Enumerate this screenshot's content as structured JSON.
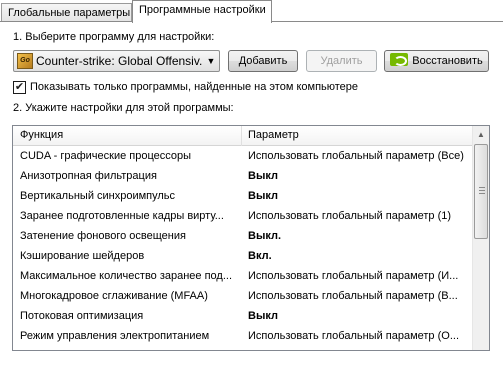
{
  "tabs": [
    {
      "label": "Глобальные параметры",
      "active": false
    },
    {
      "label": "Программные настройки",
      "active": true
    }
  ],
  "step1": {
    "label": "1. Выберите программу для настройки:",
    "program": "Counter-strike: Global Offensiv...",
    "program_icon": "csgo-icon",
    "add_label": "Добавить",
    "remove_label": "Удалить",
    "restore_label": "Восстановить",
    "restore_icon": "nvidia-icon"
  },
  "filter": {
    "checked": true,
    "label": "Показывать только программы, найденные на этом компьютере"
  },
  "step2": {
    "label": "2. Укажите настройки для этой программы:"
  },
  "grid": {
    "headers": {
      "function": "Функция",
      "parameter": "Параметр"
    },
    "rows": [
      {
        "function": "CUDA - графические процессоры",
        "value": "Использовать глобальный параметр (Все)",
        "bold": false
      },
      {
        "function": "Анизотропная фильтрация",
        "value": "Выкл",
        "bold": true
      },
      {
        "function": "Вертикальный синхроимпульс",
        "value": "Выкл",
        "bold": true
      },
      {
        "function": "Заранее подготовленные кадры вирту...",
        "value": "Использовать глобальный параметр (1)",
        "bold": false
      },
      {
        "function": "Затенение фонового освещения",
        "value": "Выкл.",
        "bold": true
      },
      {
        "function": "Кэширование шейдеров",
        "value": "Вкл.",
        "bold": true
      },
      {
        "function": "Максимальное количество заранее под...",
        "value": "Использовать глобальный параметр (И...",
        "bold": false
      },
      {
        "function": "Многокадровое сглаживание (MFAA)",
        "value": "Использовать глобальный параметр (В...",
        "bold": false
      },
      {
        "function": "Потоковая оптимизация",
        "value": "Выкл",
        "bold": true
      },
      {
        "function": "Режим управления электропитанием",
        "value": "Использовать глобальный параметр (О...",
        "bold": false
      }
    ]
  },
  "colors": {
    "nvidia_green": "#76b900",
    "border": "#828790"
  }
}
